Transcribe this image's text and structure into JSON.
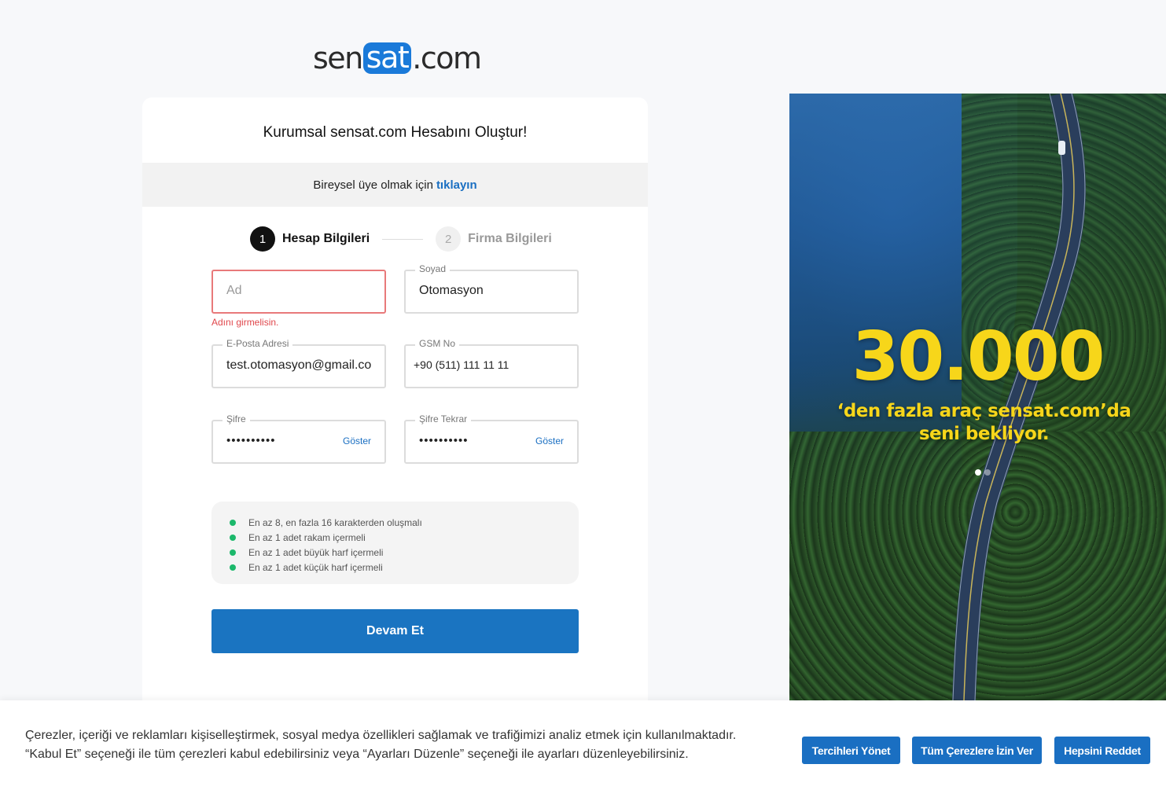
{
  "logo": {
    "part1": "sen",
    "part2": "sat",
    "part3": ".com"
  },
  "card": {
    "title": "Kurumsal sensat.com Hesabını Oluştur!",
    "banner_text": "Bireysel üye olmak için",
    "banner_link": "tıklayın"
  },
  "steps": [
    {
      "num": "1",
      "label": "Hesap Bilgileri",
      "active": true
    },
    {
      "num": "2",
      "label": "Firma Bilgileri",
      "active": false
    }
  ],
  "form": {
    "ad": {
      "placeholder": "Ad",
      "value": "",
      "error": "Adını girmelisin."
    },
    "soyad": {
      "label": "Soyad",
      "value": "Otomasyon"
    },
    "email": {
      "label": "E-Posta Adresi",
      "value": "test.otomasyon@gmail.com"
    },
    "gsm": {
      "label": "GSM No",
      "value": "+90 (511) 111 11 11"
    },
    "sifre": {
      "label": "Şifre",
      "value": "••••••••••",
      "show": "Göster"
    },
    "sifre_tekrar": {
      "label": "Şifre Tekrar",
      "value": "••••••••••",
      "show": "Göster"
    },
    "submit": "Devam Et"
  },
  "password_rules": [
    "En az 8, en fazla 16 karakterden oluşmalı",
    "En az 1 adet rakam içermeli",
    "En az 1 adet büyük harf içermeli",
    "En az 1 adet küçük harf içermeli"
  ],
  "hero": {
    "big_number": "30.000",
    "line1": "‘den fazla araç sensat.com’da",
    "line2": "seni bekliyor.",
    "slides": 2,
    "active_slide": 1
  },
  "cookie": {
    "line1": "Çerezler, içeriği ve reklamları kişiselleştirmek, sosyal medya özellikleri sağlamak ve trafiğimizi analiz etmek için kullanılmaktadır.",
    "line2": "“Kabul Et” seçeneği ile tüm çerezleri kabul edebilirsiniz veya “Ayarları Düzenle” seçeneği ile ayarları düzenleyebilirsiniz.",
    "btn_manage": "Tercihleri Yönet",
    "btn_accept": "Tüm Çerezlere İzin Ver",
    "btn_reject": "Hepsini Reddet"
  },
  "colors": {
    "accent": "#1a74c1",
    "error": "#e0474c",
    "rule_dot": "#1cb86b",
    "hero_text": "#f7d61a"
  }
}
